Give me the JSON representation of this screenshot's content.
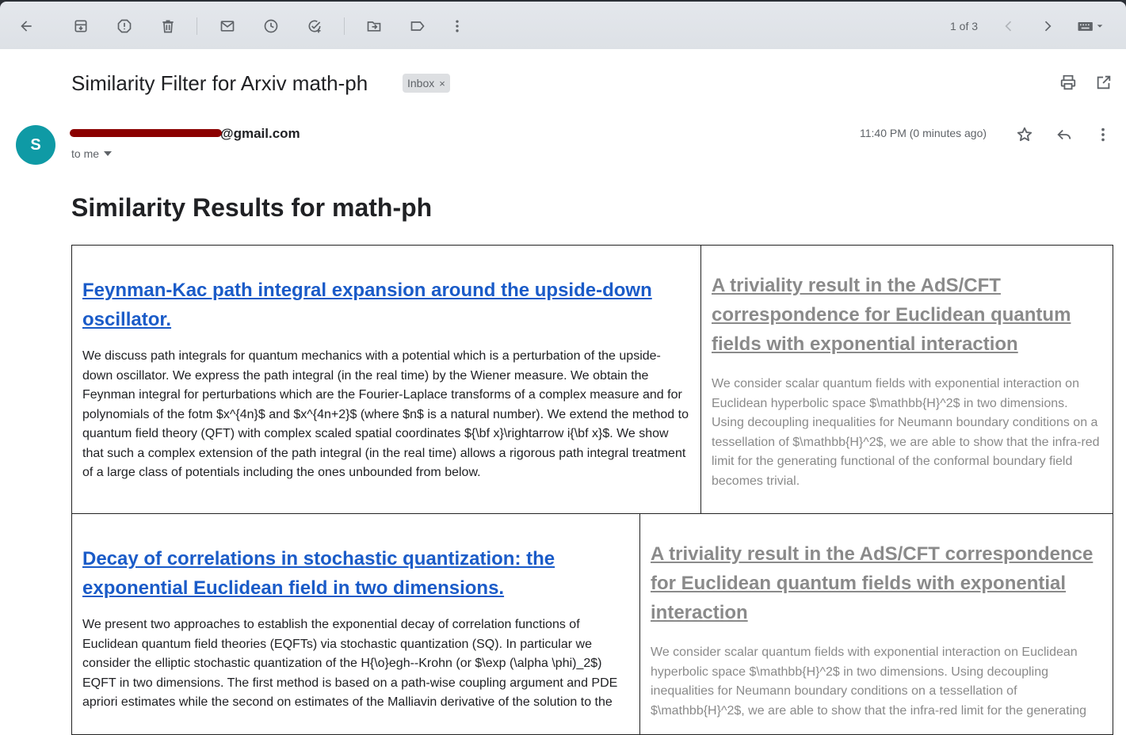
{
  "toolbar": {
    "pager": "1 of 3",
    "icons": [
      "back-icon",
      "archive-icon",
      "report-spam-icon",
      "delete-icon",
      "mark-unread-icon",
      "snooze-icon",
      "add-task-icon",
      "move-to-icon",
      "label-icon",
      "more-vert-icon",
      "newer-icon",
      "older-icon",
      "keyboard-icon"
    ]
  },
  "email": {
    "subject": "Similarity Filter for Arxiv math-ph",
    "label": "Inbox",
    "label_close": "×",
    "avatar_letter": "S",
    "sender_domain": "@gmail.com",
    "to": "to me",
    "time": "11:40 PM (0 minutes ago)"
  },
  "body": {
    "heading": "Similarity Results for math-ph",
    "rows": [
      {
        "left": {
          "title": "Feynman-Kac path integral expansion around the upside-down oscillator.",
          "abstract": "We discuss path integrals for quantum mechanics with a potential which is a perturbation of the upside-down oscillator. We express the path integral (in the real time) by the Wiener measure. We obtain the Feynman integral for perturbations which are the Fourier-Laplace transforms of a complex measure and for polynomials of the fotm $x^{4n}$ and $x^{4n+2}$ (where $n$ is a natural number). We extend the method to quantum field theory (QFT) with complex scaled spatial coordinates ${\\bf x}\\rightarrow i{\\bf x}$. We show that such a complex extension of the path integral (in the real time) allows a rigorous path integral treatment of a large class of potentials including the ones unbounded from below."
        },
        "right": {
          "title": "A triviality result in the AdS/CFT correspondence for Euclidean quantum fields with exponential interaction",
          "abstract": "We consider scalar quantum fields with exponential interaction on Euclidean hyperbolic space $\\mathbb{H}^2$ in two dimensions. Using decoupling inequalities for Neumann boundary conditions on a tessellation of $\\mathbb{H}^2$, we are able to show that the infra-red limit for the generating functional of the conformal boundary field becomes trivial."
        }
      },
      {
        "left": {
          "title": "Decay of correlations in stochastic quantization: the exponential Euclidean field in two dimensions.",
          "abstract": "We present two approaches to establish the exponential decay of correlation functions of Euclidean quantum field theories (EQFTs) via stochastic quantization (SQ). In particular we consider the elliptic stochastic quantization of the H{\\o}egh--Krohn (or $\\exp (\\alpha \\phi)_2$) EQFT in two dimensions. The first method is based on a path-wise coupling argument and PDE apriori estimates while the second on estimates of the Malliavin derivative of the solution to the"
        },
        "right": {
          "title": "A triviality result in the AdS/CFT correspondence for Euclidean quantum fields with exponential interaction",
          "abstract": "We consider scalar quantum fields with exponential interaction on Euclidean hyperbolic space $\\mathbb{H}^2$ in two dimensions. Using decoupling inequalities for Neumann boundary conditions on a tessellation of $\\mathbb{H}^2$, we are able to show that the infra-red limit for the generating"
        }
      }
    ]
  }
}
